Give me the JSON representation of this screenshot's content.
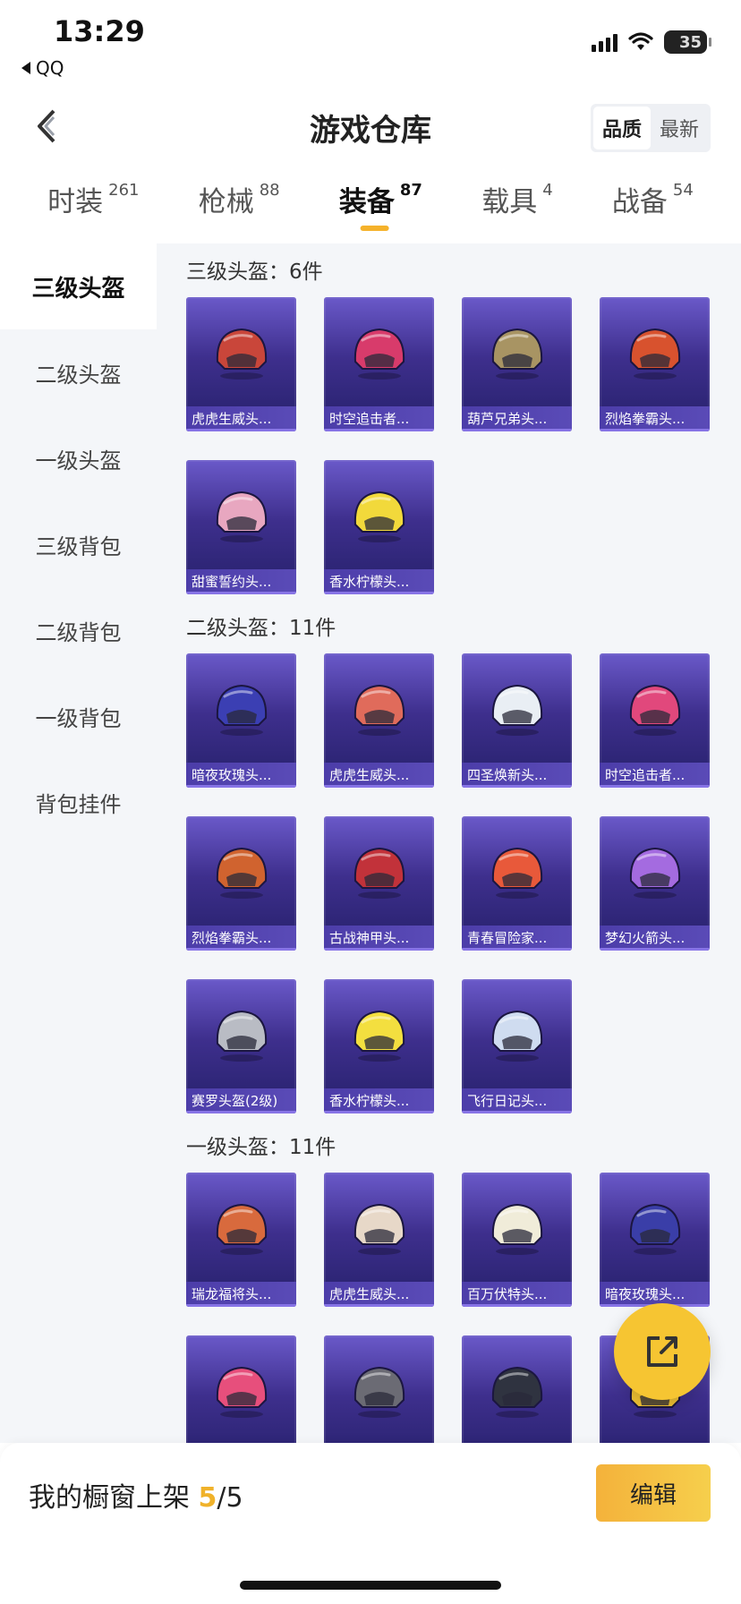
{
  "status_bar": {
    "time": "13:29",
    "back_app": "QQ",
    "battery": "35"
  },
  "header": {
    "title": "游戏仓库",
    "sort_options": [
      "品质",
      "最新"
    ],
    "sort_selected": "品质"
  },
  "tabs": [
    {
      "label": "时装",
      "count": "261"
    },
    {
      "label": "枪械",
      "count": "88"
    },
    {
      "label": "装备",
      "count": "87",
      "active": true
    },
    {
      "label": "载具",
      "count": "4"
    },
    {
      "label": "战备",
      "count": "54"
    }
  ],
  "sidebar": {
    "items": [
      "三级头盔",
      "二级头盔",
      "一级头盔",
      "三级背包",
      "二级背包",
      "一级背包",
      "背包挂件"
    ],
    "active": "三级头盔"
  },
  "sections": [
    {
      "title": "三级头盔：6件",
      "items": [
        {
          "name": "虎虎生威头...",
          "color": "#c9463a"
        },
        {
          "name": "时空追击者...",
          "color": "#d83b6b"
        },
        {
          "name": "葫芦兄弟头...",
          "color": "#a89463"
        },
        {
          "name": "烈焰拳霸头...",
          "color": "#d8522e"
        },
        {
          "name": "甜蜜誓约头...",
          "color": "#e8a7c0"
        },
        {
          "name": "香水柠檬头...",
          "color": "#f2d93b"
        }
      ]
    },
    {
      "title": "二级头盔：11件",
      "items": [
        {
          "name": "暗夜玫瑰头...",
          "color": "#3b3fb3"
        },
        {
          "name": "虎虎生威头...",
          "color": "#e06b5b"
        },
        {
          "name": "四圣焕新头...",
          "color": "#e9eef4"
        },
        {
          "name": "时空追击者...",
          "color": "#e1487c"
        },
        {
          "name": "烈焰拳霸头...",
          "color": "#d0632f"
        },
        {
          "name": "古战神甲头...",
          "color": "#c2323a"
        },
        {
          "name": "青春冒险家...",
          "color": "#e8593a"
        },
        {
          "name": "梦幻火箭头...",
          "color": "#a46be0"
        },
        {
          "name": "赛罗头盔(2级)",
          "color": "#b9bcc4"
        },
        {
          "name": "香水柠檬头...",
          "color": "#f3df3f"
        },
        {
          "name": "飞行日记头...",
          "color": "#cfdcf0"
        }
      ]
    },
    {
      "title": "一级头盔：11件",
      "items": [
        {
          "name": "瑞龙福将头...",
          "color": "#d86a3d"
        },
        {
          "name": "虎虎生威头...",
          "color": "#e7d8c8"
        },
        {
          "name": "百万伏特头...",
          "color": "#f0ecd9"
        },
        {
          "name": "暗夜玫瑰头...",
          "color": "#3a3ea8"
        },
        {
          "name": "",
          "color": "#e74f7c"
        },
        {
          "name": "",
          "color": "#6b6b74"
        },
        {
          "name": "",
          "color": "#2f3340"
        },
        {
          "name": "",
          "color": "#f1c334"
        }
      ]
    }
  ],
  "bottom_bar": {
    "shelf_label": "我的橱窗上架",
    "shelf_current": "5",
    "shelf_total": "/5",
    "edit_label": "编辑"
  }
}
